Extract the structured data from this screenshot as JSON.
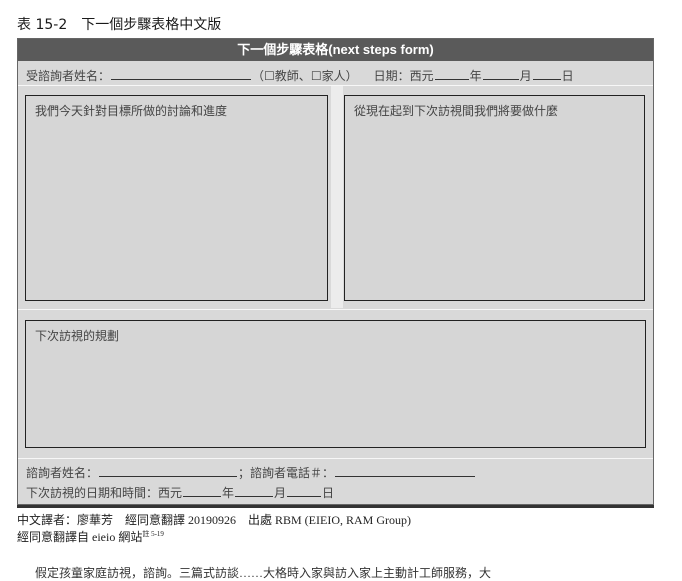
{
  "caption": "表 15-2　下一個步驟表格中文版",
  "form": {
    "title": "下一個步驟表格(next steps form)",
    "consultee": {
      "label": "受諮詢者姓名：",
      "open_paren": "（",
      "opt_teacher_box": "☐",
      "opt_teacher": "教師、",
      "opt_family_box": "☐",
      "opt_family": "家人）",
      "date_label": "日期：西元",
      "year": "年",
      "month": "月",
      "day": "日"
    },
    "box_discussion": "我們今天針對目標所做的討論和進度",
    "box_next": "從現在起到下次訪視間我們將要做什麼",
    "box_plan": "下次訪視的規劃",
    "consultant": {
      "name_label": "諮詢者姓名：",
      "phone_label": "；諮詢者電話＃：",
      "visit_label": "下次訪視的日期和時間：西元",
      "year": "年",
      "month": "月",
      "day": "日"
    }
  },
  "credits": {
    "line1": "中文譯者：廖華芳　經同意翻譯 20190926　出處 RBM (EIEIO, RAM Group)",
    "line2": "經同意翻譯自 eieio 網站",
    "note_ref": "註 5-19"
  },
  "cut_text": "假定孩童家庭訪視，諮詢。三篇式訪談……大格時入家與訪入家上主動計工師服務，大"
}
